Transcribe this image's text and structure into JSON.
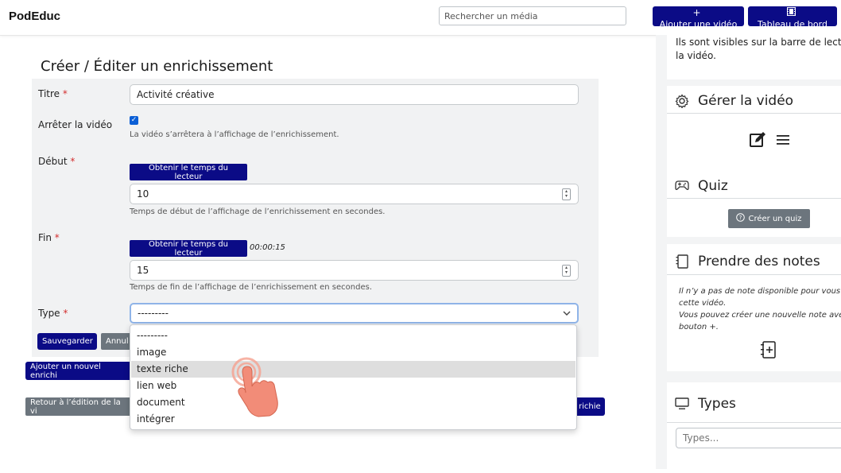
{
  "header": {
    "brand": "PodEduc",
    "search_placeholder": "Rechercher un média",
    "add_video_label": "Ajouter une vidéo",
    "dashboard_label": "Tableau de bord"
  },
  "form": {
    "title": "Créer / Éditer un enrichissement",
    "titre_label": "Titre",
    "titre_value": "Activité créative",
    "stop_label": "Arrêter la vidéo",
    "stop_help": "La vidéo s’arrêtera à l’affichage de l’enrichissement.",
    "debut_label": "Début",
    "get_time_label": "Obtenir le temps du lecteur",
    "debut_value": "10",
    "debut_help": "Temps de début de l’affichage de l’enrichissement en secondes.",
    "fin_label": "Fin",
    "fin_time": "00:00:15",
    "fin_value": "15",
    "fin_help": "Temps de fin de l’affichage de l’enrichissement en secondes.",
    "type_label": "Type",
    "type_value": "---------",
    "required_mark": "*",
    "save_label": "Sauvegarder",
    "cancel_label_partial": "Annul",
    "type_options": [
      "---------",
      "image",
      "texte riche",
      "lien web",
      "document",
      "intégrer"
    ],
    "highlighted_option": "texte riche"
  },
  "actions": {
    "add_new_partial": "Ajouter un nouvel enrichi",
    "back_partial": "Retour à l’édition de la vi",
    "right_partial": "richie"
  },
  "right_panel": {
    "top_text_line1": "Ils sont visibles sur la barre de lectur",
    "top_text_line2": "la vidéo.",
    "manage_title": "Gérer la vidéo",
    "quiz_title": "Quiz",
    "create_quiz_label": "Créer un quiz",
    "notes_title": "Prendre des notes",
    "notes_line1": "Il n’y a pas de note disponible pour vous pou",
    "notes_line2": "cette vidéo.",
    "notes_line3": "Vous pouvez créer une nouvelle note avec le",
    "notes_line4": "bouton +.",
    "types_title": "Types",
    "types_placeholder": "Types..."
  },
  "colors": {
    "navy": "#0b0b86",
    "grey_button": "#6c757d",
    "required": "#d32f2f",
    "checkbox": "#0b5fd6",
    "hand": "#f28c78"
  },
  "icons": [
    "plus-icon",
    "film-icon",
    "gear-icon",
    "edit-icon",
    "menu-icon",
    "gamepad-icon",
    "question-circle-icon",
    "notebook-icon",
    "add-note-icon",
    "monitor-icon",
    "chevron-down-icon",
    "pointer-hand-icon"
  ]
}
